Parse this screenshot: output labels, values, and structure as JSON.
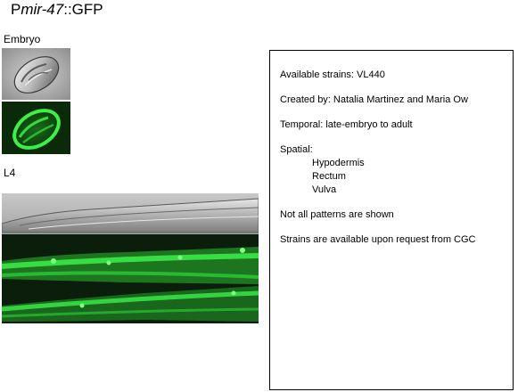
{
  "title": {
    "prefix": "P",
    "gene": "mir-47",
    "suffix": "::GFP"
  },
  "panels": {
    "embryo_label": "Embryo",
    "l4_label": "L4"
  },
  "colors": {
    "gfp_green": "#2ee83a",
    "background_dark": "#0a1a0a",
    "dic_gray": "#bdbdbd"
  },
  "info": {
    "available_strains": "Available strains: VL440",
    "created_by": "Created by: Natalia Martinez and Maria Ow",
    "temporal": "Temporal: late-embryo to adult",
    "spatial_label": "Spatial:",
    "spatial_items": [
      "Hypodermis",
      "Rectum",
      "Vulva"
    ],
    "note": "Not all patterns are shown",
    "availability": "Strains are available upon request from CGC"
  }
}
